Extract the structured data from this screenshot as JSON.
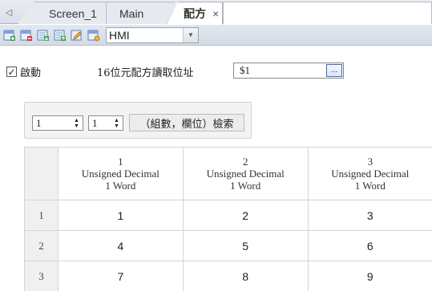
{
  "tabs": {
    "scroll_glyph": "◁",
    "items": [
      {
        "label": "Screen_1"
      },
      {
        "label": "Main"
      },
      {
        "label": "配方",
        "close": "×"
      }
    ]
  },
  "toolbar": {
    "icons": [
      "add-row-icon",
      "delete-row-icon",
      "import-icon",
      "export-icon",
      "edit-icon",
      "settings-icon"
    ],
    "target_select": {
      "value": "HMI"
    }
  },
  "settings": {
    "enable_checked": true,
    "enable_check_glyph": "✓",
    "enable_label": "啟動",
    "address_label": "16位元配方讀取位址",
    "address_value": "$1",
    "address_button": "..."
  },
  "search": {
    "group_value": "1",
    "field_value": "1",
    "button_label": "（組數，欄位）檢索"
  },
  "table": {
    "columns": [
      {
        "index": "1",
        "type": "Unsigned Decimal",
        "size": "1 Word"
      },
      {
        "index": "2",
        "type": "Unsigned Decimal",
        "size": "1 Word"
      },
      {
        "index": "3",
        "type": "Unsigned Decimal",
        "size": "1 Word"
      }
    ],
    "rows": [
      {
        "num": "1",
        "cells": [
          "1",
          "2",
          "3"
        ]
      },
      {
        "num": "2",
        "cells": [
          "4",
          "5",
          "6"
        ]
      },
      {
        "num": "3",
        "cells": [
          "7",
          "8",
          "9"
        ]
      }
    ]
  }
}
